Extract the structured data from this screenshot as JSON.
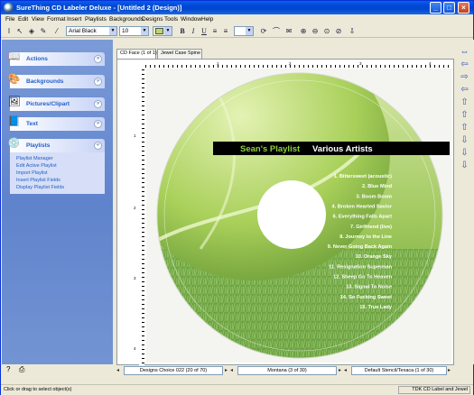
{
  "window": {
    "title": "SureThing CD Labeler Deluxe - [Untitled 2 (Design)]",
    "minimize_glyph": "_",
    "maximize_glyph": "□",
    "close_glyph": "×"
  },
  "menu": [
    "File",
    "Edit",
    "View",
    "Format",
    "Insert",
    "Playlists",
    "Backgrounds",
    "Designs",
    "Tools",
    "Window",
    "Help"
  ],
  "toolbar": {
    "font_name": "Arial Black",
    "font_size": "10",
    "bold_label": "B",
    "italic_label": "I",
    "underline_label": "U",
    "icons": [
      "text-cursor-icon",
      "pointer-icon",
      "paint-bucket-icon",
      "pen-icon",
      "eyedropper-icon",
      "zoom-in-icon",
      "zoom-out-icon",
      "zoom-fit-icon",
      "undo-icon"
    ]
  },
  "taskpane": {
    "panels": [
      {
        "label": "Actions",
        "icon": "book-icon",
        "expanded": false
      },
      {
        "label": "Backgrounds",
        "icon": "backgrounds-icon",
        "expanded": false
      },
      {
        "label": "Pictures/Clipart",
        "icon": "picture-icon",
        "expanded": false
      },
      {
        "label": "Text",
        "icon": "text-icon",
        "expanded": false
      },
      {
        "label": "Playlists",
        "icon": "playlist-icon",
        "expanded": true,
        "links": [
          "Playlist Manager",
          "Edit Active Playlist",
          "Import Playlist",
          "Insert Playlist Fields",
          "Display Playlist Fields"
        ]
      }
    ]
  },
  "doc_tabs": [
    "CD Face (1 of 1)",
    "Jewel Case Spine"
  ],
  "cd": {
    "title_left": "Sean's Playlist",
    "title_right": "Various Artists",
    "tracks": [
      "1. Bittersweet (acoustic)",
      "2. Blue Mind",
      "3. Boom Boom",
      "4. Broken Hearted Savior",
      "6. Everything Falls Apart",
      "7. Girlfriend (live)",
      "8. Journey to the Line",
      "9. Never Going Back Again",
      "10. Orange Sky",
      "11. Resignation Superman",
      "12. Sheep Go To Heaven",
      "13. Signal To Noise",
      "14. So Fucking Sweet",
      "15. True Lady"
    ],
    "colors": {
      "green_light": "#b9d96a",
      "green_dark": "#6e9f3a",
      "title_green": "#8fd13c",
      "band": "#000000"
    }
  },
  "ruler": {
    "h_labels": [
      "1",
      "2",
      "3",
      "4"
    ],
    "v_labels": [
      "1",
      "2",
      "3",
      "4"
    ]
  },
  "navigators": [
    {
      "value": "Designs Choice 022 (20 of 70)"
    },
    {
      "value": "Montana (3 of 30)"
    },
    {
      "value": "Default Stencil/Texaca (1 of 30)"
    }
  ],
  "status": {
    "left": "Click or drag to select object(s)",
    "right": "TDK CD Label and Jewel"
  }
}
